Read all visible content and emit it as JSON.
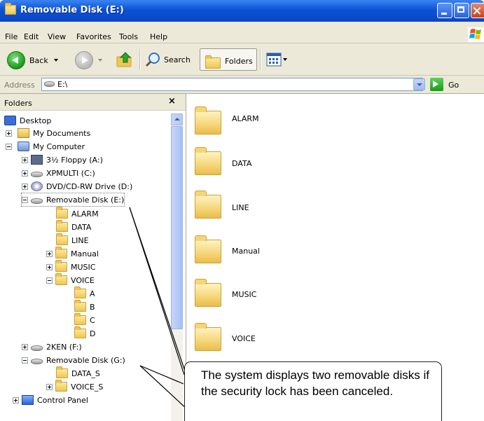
{
  "window": {
    "title": "Removable Disk (E:)",
    "accent": "#0b52d6"
  },
  "menubar": {
    "items": [
      "File",
      "Edit",
      "View",
      "Favorites",
      "Tools",
      "Help"
    ]
  },
  "toolbar": {
    "back_label": "Back",
    "search_label": "Search",
    "folders_label": "Folders"
  },
  "address": {
    "label": "Address",
    "value": "E:\\",
    "go_label": "Go"
  },
  "folder_pane": {
    "title": "Folders",
    "tree": [
      {
        "label": "Desktop",
        "icon": "desktop-icon"
      },
      {
        "label": "My Documents",
        "icon": "my-documents-icon"
      },
      {
        "label": "My Computer",
        "icon": "my-computer-icon"
      },
      {
        "label": "3½ Floppy (A:)",
        "icon": "floppy-icon"
      },
      {
        "label": "XPMULTI (C:)",
        "icon": "drive-icon"
      },
      {
        "label": "DVD/CD-RW Drive (D:)",
        "icon": "dvd-icon"
      },
      {
        "label": "Removable Disk (E:)",
        "icon": "drive-icon"
      },
      {
        "label": "ALARM",
        "icon": "folder-icon"
      },
      {
        "label": "DATA",
        "icon": "folder-icon"
      },
      {
        "label": "LINE",
        "icon": "folder-icon"
      },
      {
        "label": "Manual",
        "icon": "folder-icon"
      },
      {
        "label": "MUSIC",
        "icon": "folder-icon"
      },
      {
        "label": "VOICE",
        "icon": "folder-icon"
      },
      {
        "label": "A",
        "icon": "folder-icon"
      },
      {
        "label": "B",
        "icon": "folder-icon"
      },
      {
        "label": "C",
        "icon": "folder-icon"
      },
      {
        "label": "D",
        "icon": "folder-icon"
      },
      {
        "label": "2KEN (F:)",
        "icon": "drive-icon"
      },
      {
        "label": "Removable Disk (G:)",
        "icon": "drive-icon"
      },
      {
        "label": "DATA_S",
        "icon": "folder-icon"
      },
      {
        "label": "VOICE_S",
        "icon": "folder-icon"
      },
      {
        "label": "Control Panel",
        "icon": "control-panel-icon"
      }
    ]
  },
  "content": {
    "folders": [
      "ALARM",
      "DATA",
      "LINE",
      "Manual",
      "MUSIC",
      "VOICE"
    ]
  },
  "callout": {
    "text": "The system displays two removable disks if the security lock has been canceled."
  }
}
